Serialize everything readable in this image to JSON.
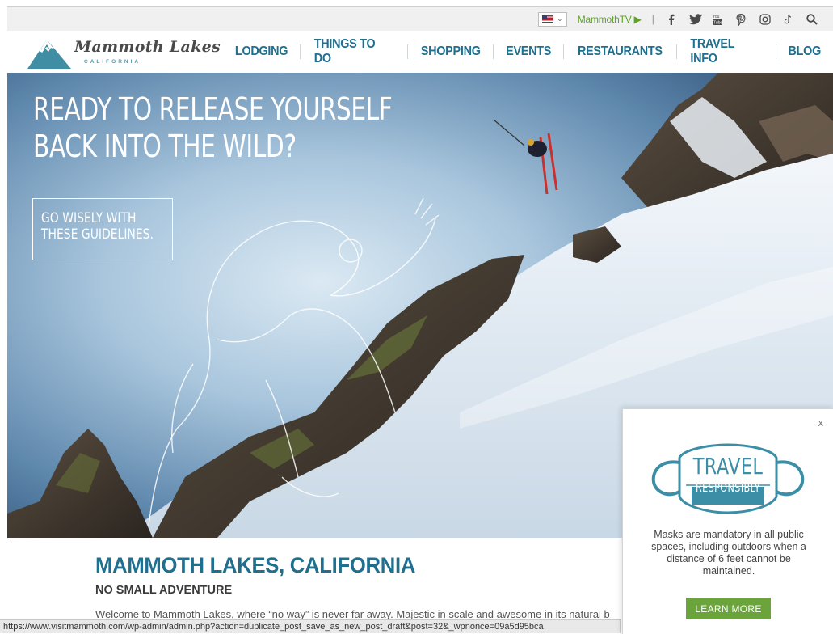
{
  "utility": {
    "flag_chevron": "⌄",
    "mammoth_tv": "MammothTV",
    "play_glyph": "▶",
    "separator": "|",
    "icons": [
      "facebook-icon",
      "twitter-icon",
      "youtube-icon",
      "pinterest-icon",
      "instagram-icon",
      "tiktok-icon",
      "search-icon"
    ]
  },
  "logo": {
    "wordmark": "Mammoth Lakes",
    "subtitle": "CALIFORNIA"
  },
  "nav": {
    "items": [
      "LODGING",
      "THINGS TO DO",
      "SHOPPING",
      "EVENTS",
      "RESTAURANTS",
      "TRAVEL INFO",
      "BLOG"
    ]
  },
  "hero": {
    "headline_line1": "READY TO RELEASE YOURSELF",
    "headline_line2": "BACK INTO THE WILD?",
    "cta_line1": "GO WISELY WITH",
    "cta_line2": "THESE GUIDELINES."
  },
  "content": {
    "title": "MAMMOTH LAKES, CALIFORNIA",
    "subtitle": "NO SMALL ADVENTURE",
    "body": "Welcome to Mammoth Lakes, where “no way” is never far away. Majestic in scale and awesome in its natural b"
  },
  "status_url": "https://www.visitmammoth.com/wp-admin/admin.php?action=duplicate_post_save_as_new_post_draft&post=32&_wpnonce=09a5d95bca",
  "popup": {
    "close": "x",
    "badge_line1": "TRAVEL",
    "badge_line2": "RESPONSIBLY",
    "message": "Masks are mandatory in all public spaces, including outdoors when a distance of 6 feet cannot be maintained.",
    "button": "LEARN MORE"
  },
  "colors": {
    "brand_blue": "#1f6f8f",
    "accent_green": "#6aa43a",
    "badge_teal": "#3b8ea5"
  }
}
